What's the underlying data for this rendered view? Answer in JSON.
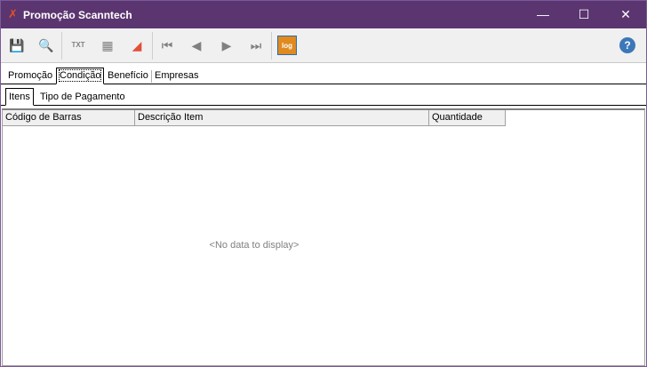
{
  "window": {
    "title": "Promoção Scanntech"
  },
  "toolbar": {
    "buttons": [
      "save-icon",
      "search-icon",
      "export-txt-icon",
      "grid-icon",
      "eraser-icon",
      "first-record-icon",
      "previous-record-icon",
      "next-record-icon",
      "last-record-icon",
      "log-icon",
      "help-icon"
    ],
    "log_label": "log",
    "txt_label": "TXT"
  },
  "tabs": [
    {
      "label": "Promoção"
    },
    {
      "label": "Condição"
    },
    {
      "label": "Benefício"
    },
    {
      "label": "Empresas"
    }
  ],
  "subtabs": [
    {
      "label": "Itens"
    },
    {
      "label": "Tipo de Pagamento"
    }
  ],
  "grid": {
    "columns": [
      "Código de Barras",
      "Descrição Item",
      "Quantidade"
    ],
    "empty_text": "<No data to display>"
  }
}
